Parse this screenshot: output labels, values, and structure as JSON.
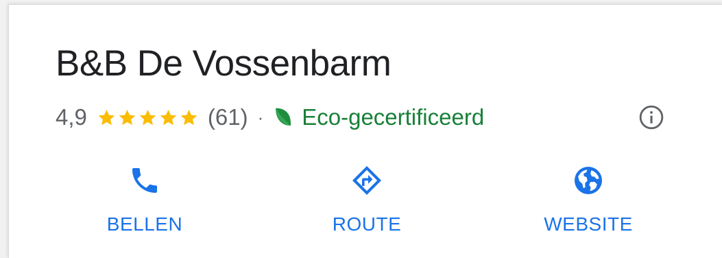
{
  "place": {
    "name": "B&B De Vossenbarm",
    "rating": "4,9",
    "stars": 5,
    "review_count": "(61)",
    "separator": "·",
    "eco_label": "Eco-gecertificeerd"
  },
  "icons": {
    "star": "star-icon",
    "leaf": "leaf-icon",
    "info": "info-icon",
    "call": "phone-icon",
    "route": "directions-icon",
    "website": "globe-icon"
  },
  "actions": {
    "call_label": "BELLEN",
    "route_label": "ROUTE",
    "website_label": "WEBSITE"
  },
  "colors": {
    "text": "#202124",
    "secondary_text": "#5f6368",
    "star": "#fbbc04",
    "eco": "#188038",
    "accent": "#1a73e8"
  }
}
